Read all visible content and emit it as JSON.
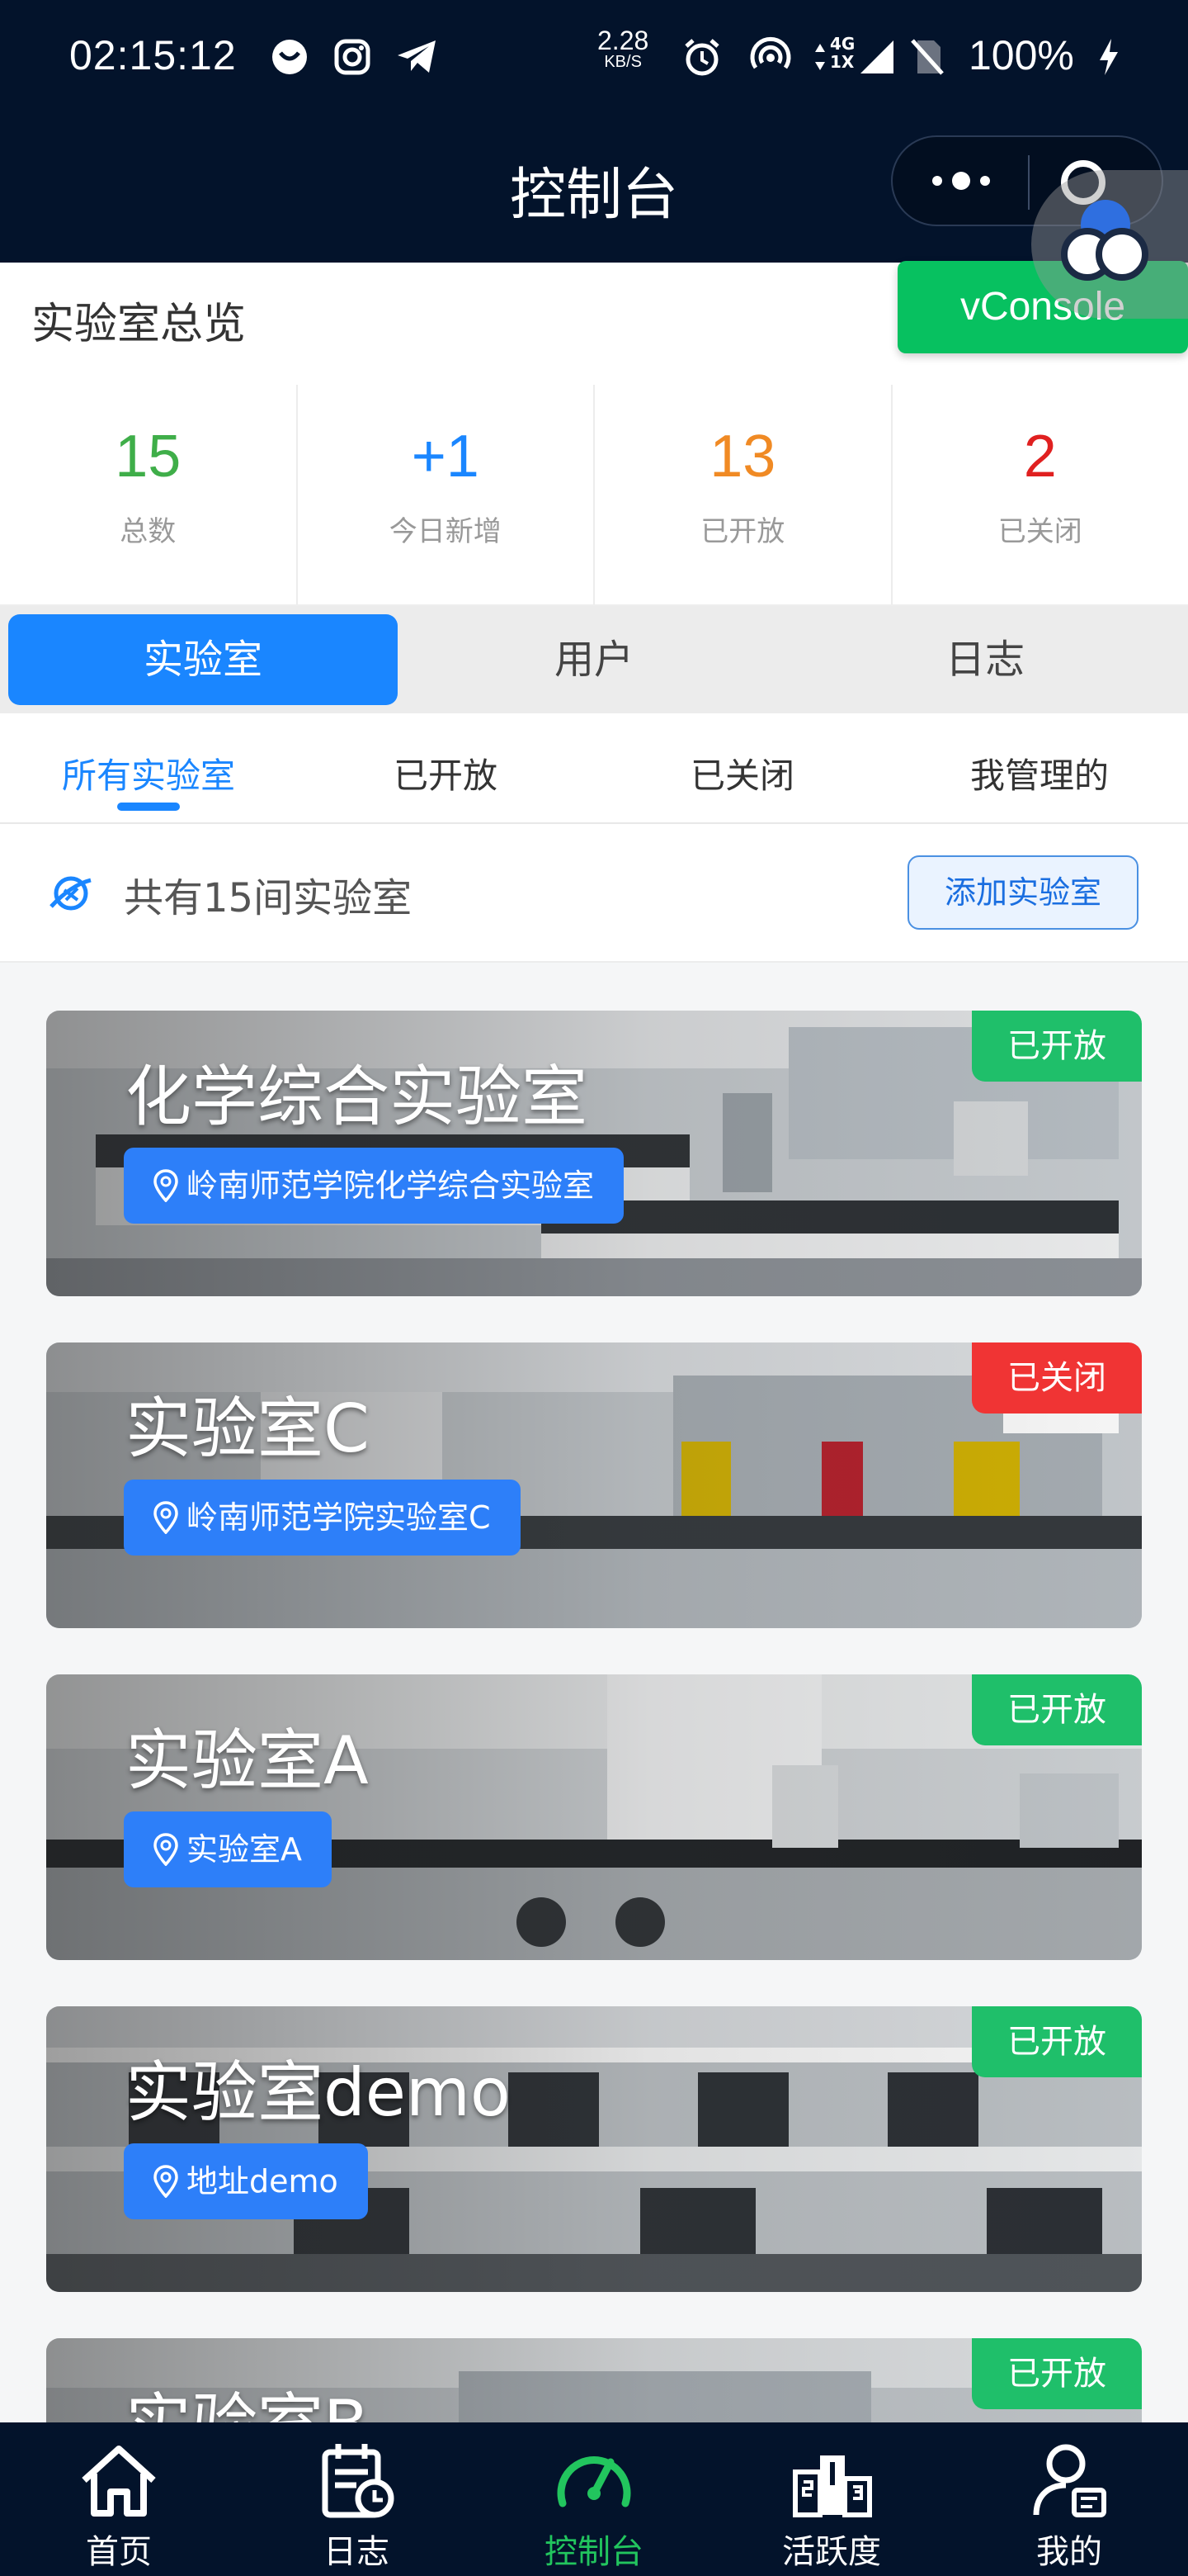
{
  "status_bar": {
    "time": "02:15:12",
    "speed_value": "2.28",
    "speed_unit": "KB/S",
    "network_top": "4G",
    "network_bottom": "1X",
    "battery": "100%"
  },
  "navbar": {
    "title": "控制台"
  },
  "vconsole": {
    "label": "vConsole"
  },
  "overview": {
    "title": "实验室总览",
    "stats": [
      {
        "value": "15",
        "label": "总数",
        "color": "#3fae49"
      },
      {
        "value": "+1",
        "label": "今日新增",
        "color": "#1a86ff"
      },
      {
        "value": "13",
        "label": "已开放",
        "color": "#f08a24"
      },
      {
        "value": "2",
        "label": "已关闭",
        "color": "#e02020"
      }
    ]
  },
  "segment_tabs": [
    {
      "label": "实验室",
      "active": true
    },
    {
      "label": "用户",
      "active": false
    },
    {
      "label": "日志",
      "active": false
    }
  ],
  "sub_tabs": [
    {
      "label": "所有实验室",
      "active": true
    },
    {
      "label": "已开放",
      "active": false
    },
    {
      "label": "已关闭",
      "active": false
    },
    {
      "label": "我管理的",
      "active": false
    }
  ],
  "lab_count": {
    "text": "共有15间实验室",
    "add_button": "添加实验室"
  },
  "labs": [
    {
      "name": "化学综合实验室",
      "location": "岭南师范学院化学综合实验室",
      "status": "已开放",
      "status_color": "#1fbf6a"
    },
    {
      "name": "实验室C",
      "location": "岭南师范学院实验室C",
      "status": "已关闭",
      "status_color": "#f03434"
    },
    {
      "name": "实验室A",
      "location": "实验室A",
      "status": "已开放",
      "status_color": "#1fbf6a"
    },
    {
      "name": "实验室demo",
      "location": "地址demo",
      "status": "已开放",
      "status_color": "#1fbf6a"
    },
    {
      "name": "实验室B",
      "location": "",
      "status": "已开放",
      "status_color": "#1fbf6a"
    }
  ],
  "tabbar": [
    {
      "label": "首页",
      "icon": "home-icon",
      "active": false
    },
    {
      "label": "日志",
      "icon": "calendar-clock-icon",
      "active": false
    },
    {
      "label": "控制台",
      "icon": "dashboard-gauge-icon",
      "active": true
    },
    {
      "label": "活跃度",
      "icon": "podium-ranking-icon",
      "active": false
    },
    {
      "label": "我的",
      "icon": "user-profile-icon",
      "active": false
    }
  ],
  "colors": {
    "primary": "#1a86ff",
    "navbar_bg": "#03132b",
    "tab_active": "#22c55e",
    "vconsole_green": "#07c160"
  }
}
